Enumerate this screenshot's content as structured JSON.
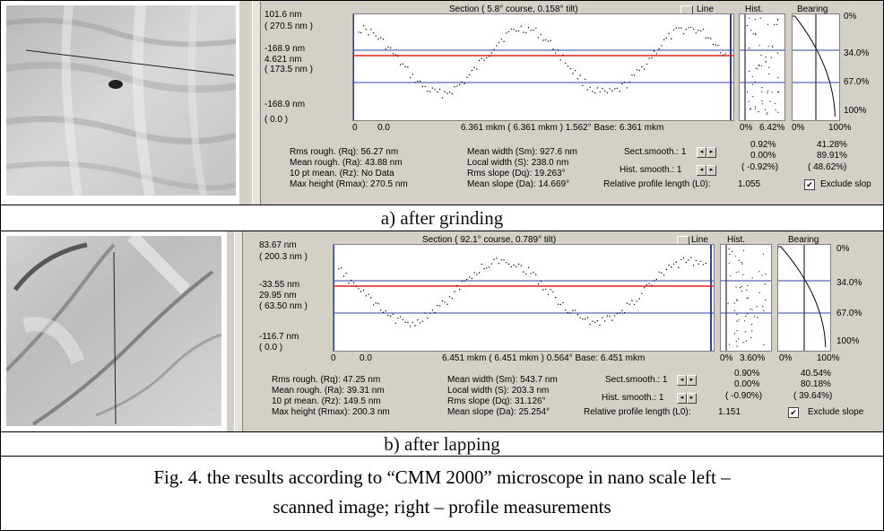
{
  "panels": [
    {
      "section_title": "Section ( 5.8° course,  0.158° tilt)",
      "line_label": "Line",
      "hist_label": "Hist.",
      "bearing_label": "Bearing",
      "y_top": "101.6 nm",
      "y_top_paren": "( 270.5 nm )",
      "y_mid": "-168.9 nm",
      "y_mid2": "4.621 nm",
      "y_mid2_paren": "( 173.5 nm )",
      "y_bottom": "-168.9 nm",
      "y_bottom_paren": "( 0.0 )",
      "x_zero": "0",
      "x_start": "0.0",
      "x_readout": "6.361 mkm    ( 6.361 mkm )  1.562°    Base:  6.361 mkm",
      "hist_scale_left": "0%",
      "hist_scale_right": "6.42%",
      "bearing_scale_left": "0%",
      "bearing_scale_right": "100%",
      "bearing_ticks": [
        "0%",
        "34.0%",
        "67.0%",
        "100%"
      ],
      "stats_col1": [
        "Rms rough.  (Rq):  56.27 nm",
        "Mean rough.  (Ra):  43.88 nm",
        "10 pt mean.  (Rz): No Data",
        "Max height (Rmax):  270.5 nm"
      ],
      "stats_col2": [
        "Mean width  (Sm):  927.6 nm",
        "Local width  (S):  238.0 nm",
        "Rms slope  (Dq):  19.263°",
        "Mean slope  (Da):  14.669°"
      ],
      "sect_smooth": "Sect.smooth.: 1",
      "hist_smooth": "Hist. smooth.: 1",
      "rel_profile": "Relative profile length  (L0):",
      "rel_profile_value": "1.055",
      "pct_col1": [
        "0.92%",
        "0.00%",
        "( -0.92%)"
      ],
      "pct_col2": [
        "41.28%",
        "89.91%",
        "( 48.62%)"
      ],
      "exclude_label": "Exclude slop",
      "caption": "a) after grinding"
    },
    {
      "section_title": "Section ( 92.1° course,  0.789° tilt)",
      "line_label": "Line",
      "hist_label": "Hist.",
      "bearing_label": "Bearing",
      "y_top": "83.67 nm",
      "y_top_paren": "( 200.3 nm )",
      "y_mid": "-33.55 nm",
      "y_mid2": "29.95 nm",
      "y_mid2_paren": "( 63.50 nm )",
      "y_bottom": "-116.7 nm",
      "y_bottom_paren": "( 0.0 )",
      "x_zero": "0",
      "x_start": "0.0",
      "x_readout": "6.451 mkm    ( 6.451 mkm )  0.564°    Base:  6.451 mkm",
      "hist_scale_left": "0%",
      "hist_scale_right": "3.60%",
      "bearing_scale_left": "0%",
      "bearing_scale_right": "100%",
      "bearing_ticks": [
        "0%",
        "34.0%",
        "67.0%",
        "100%"
      ],
      "stats_col1": [
        "Rms rough.  (Rq):  47.25 nm",
        "Mean rough.  (Ra):  39.31 nm",
        "10 pt mean.  (Rz):  149.5 nm",
        "Max height (Rmax):  200.3 nm"
      ],
      "stats_col2": [
        "Mean width  (Sm):  543.7 nm",
        "Local width  (S):  203.3 nm",
        "Rms slope  (Dq):  31.126°",
        "Mean slope  (Da):  25.254°"
      ],
      "sect_smooth": "Sect.smooth.: 1",
      "hist_smooth": "Hist. smooth.: 1",
      "rel_profile": "Relative profile length  (L0):",
      "rel_profile_value": "1.151",
      "pct_col1": [
        "0.90%",
        "0.00%",
        "( -0.90%)"
      ],
      "pct_col2": [
        "40.54%",
        "80.18%",
        "( 39.64%)"
      ],
      "exclude_label": "Exclude slope",
      "caption": "b) after lapping"
    }
  ],
  "figure_caption_line1": "Fig. 4. the results according to “CMM 2000” microscope in nano scale left –",
  "figure_caption_line2": "scanned image;  right – profile measurements",
  "colors": {
    "window_bg": "#d4d0c8",
    "mean_line": "#e02020",
    "band_line": "#3040a0",
    "profile_points": "#000000"
  }
}
